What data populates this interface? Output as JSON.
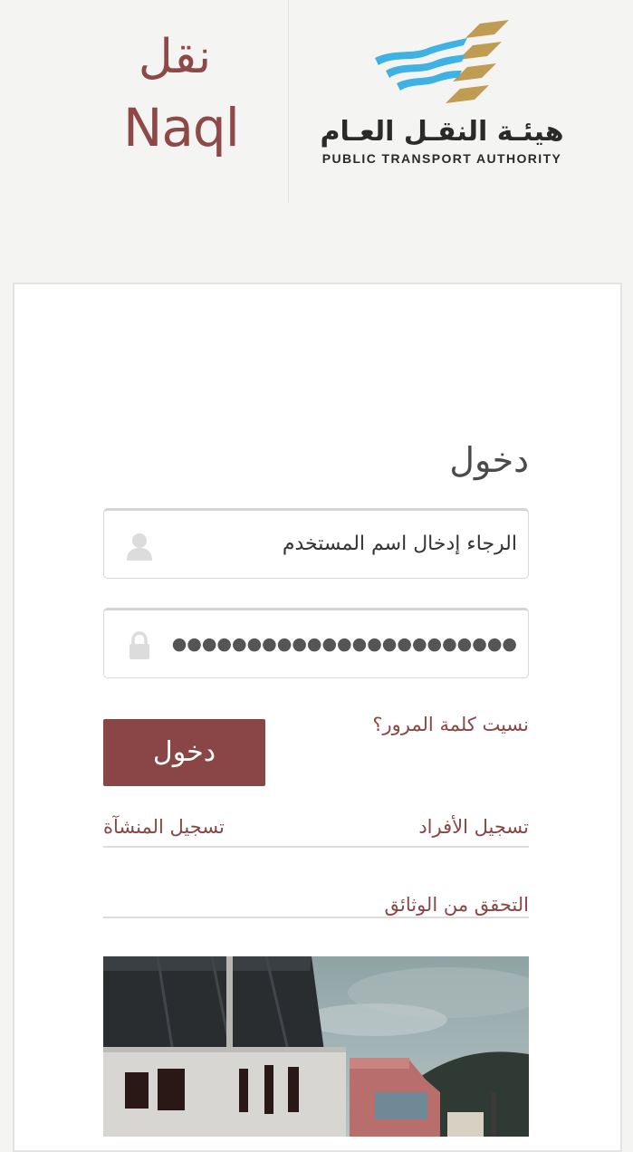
{
  "header": {
    "naql_logo": {
      "arabic": "نقل",
      "english": "Naql"
    },
    "authority_logo": {
      "arabic": "هيئـة النقـل العـام",
      "english": "PUBLIC TRANSPORT AUTHORITY"
    }
  },
  "login": {
    "title": "دخول",
    "username": {
      "placeholder": "الرجاء إدخال اسم المستخدم",
      "icon": "user-icon"
    },
    "password": {
      "value": "●●●●●●●●●●●●●●●●●●●●●●●",
      "icon": "lock-icon"
    },
    "forgot_password": "نسيت كلمة المرور؟",
    "submit_label": "دخول"
  },
  "links": {
    "register_individuals": "تسجيل الأفراد",
    "register_establishment": "تسجيل المنشآة",
    "verify_documents": "التحقق من الوثائق"
  },
  "colors": {
    "brand": "#8a4646",
    "emblem_blue": "#3fb2e4",
    "emblem_gold": "#c09b52"
  }
}
